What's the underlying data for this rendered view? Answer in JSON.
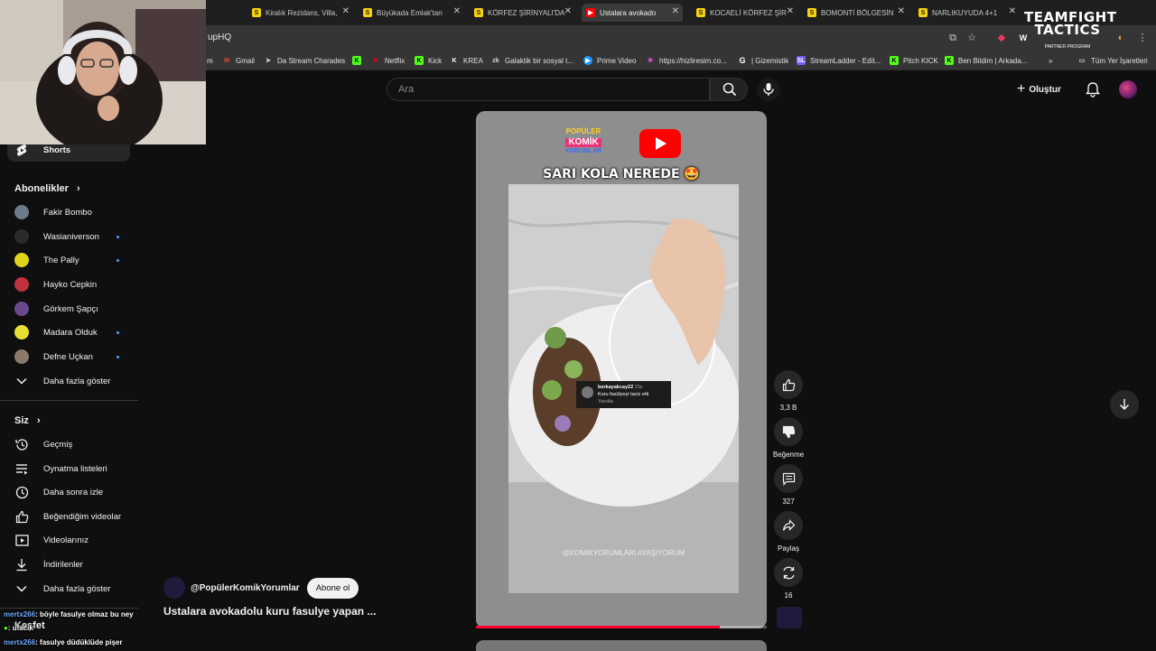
{
  "browser": {
    "tabs": [
      {
        "label": "Kiralık Rezidans, Villa,",
        "icon": "sahibinden-icon"
      },
      {
        "label": "Büyükada Emlak'tan",
        "icon": "sahibinden-icon"
      },
      {
        "label": "KÖRFEZ ŞİRİNYALI'DA",
        "icon": "sahibinden-icon"
      },
      {
        "label": "Ustalara avokado",
        "icon": "youtube-icon",
        "active": true
      },
      {
        "label": "KOCAELİ KÖRFEZ ŞİR",
        "icon": "sahibinden-icon"
      },
      {
        "label": "BOMONTİ BÖLGESİN",
        "icon": "sahibinden-icon"
      },
      {
        "label": "NARLIKUYUDA 4+1",
        "icon": "sahibinden-icon"
      }
    ],
    "url_visible": "upHQ",
    "bookmarks": [
      {
        "label": "m",
        "icon": "generic"
      },
      {
        "label": "Gmail",
        "icon": "gmail"
      },
      {
        "label": "Da Stream Charades",
        "icon": "charades"
      },
      {
        "label": "",
        "icon": "kick"
      },
      {
        "label": "Netflix",
        "icon": "netflix"
      },
      {
        "label": "Kick",
        "icon": "kick"
      },
      {
        "label": "KREA",
        "icon": "krea"
      },
      {
        "label": "Galaktik bir sosyal t...",
        "icon": "zk"
      },
      {
        "label": "Prime Video",
        "icon": "prime"
      },
      {
        "label": "https://hizliresim.co...",
        "icon": "hizli"
      },
      {
        "label": "| Gizemistik",
        "icon": "g"
      },
      {
        "label": "StreamLadder - Edit...",
        "icon": "sl"
      },
      {
        "label": "Pitch KICK",
        "icon": "kick"
      },
      {
        "label": "Ben Bildim | Arkada...",
        "icon": "kick"
      },
      {
        "label": "Tüm Yer İşaretleri",
        "icon": "folder"
      }
    ],
    "overflow_chevron": "»"
  },
  "header": {
    "search_placeholder": "Ara",
    "create_label": "Oluştur",
    "create_symbol": "+"
  },
  "sidebar": {
    "shorts_label": "Shorts",
    "subscriptions_heading": "Abonelikler",
    "subscriptions_arrow": "›",
    "channels": [
      {
        "name": "Fakir Bombo",
        "color": "#6b7b8c",
        "new": false
      },
      {
        "name": "Wasianiverson",
        "color": "#2b2b2b",
        "new": true
      },
      {
        "name": "The Pally",
        "color": "#e0d31b",
        "new": true
      },
      {
        "name": "Hayko Cepkin",
        "color": "#c0323c",
        "new": false
      },
      {
        "name": "Görkem Şapçı",
        "color": "#6a4a8c",
        "new": false
      },
      {
        "name": "Madara Olduk",
        "color": "#e8e032",
        "new": true
      },
      {
        "name": "Defne Uçkan",
        "color": "#8a7a6a",
        "new": true
      }
    ],
    "show_more_subs": "Daha fazla göster",
    "you_heading": "Siz",
    "you_arrow": "›",
    "you_items": [
      {
        "label": "Geçmiş",
        "icon": "history-icon"
      },
      {
        "label": "Oynatma listeleri",
        "icon": "playlists-icon"
      },
      {
        "label": "Daha sonra izle",
        "icon": "watch-later-icon"
      },
      {
        "label": "Beğendiğim videolar",
        "icon": "liked-videos-icon"
      },
      {
        "label": "Videolarınız",
        "icon": "your-videos-icon"
      },
      {
        "label": "İndirilenler",
        "icon": "downloads-icon"
      },
      {
        "label": "Daha fazla göster",
        "icon": "chevron-down-icon"
      }
    ],
    "explore_heading": "Keşfet"
  },
  "chat": [
    {
      "user": "mertx266",
      "message": ": böyle fasulye olmaz bu ney"
    },
    {
      "user": "",
      "message": ": ufacık"
    },
    {
      "user": "mertx266",
      "message": ": fasulye düdüklüde pişer"
    }
  ],
  "short": {
    "brand_line1": "POPÜLER",
    "brand_line2": "KOMİK",
    "brand_line3": "YORUMLAR",
    "overlay_caption": "SARI KOLA NEREDE",
    "overlay_emoji": "🤩",
    "comment_user": "berkayakcay22",
    "comment_time": "23s",
    "comment_text": "Kuru fasülyeyi taciz etti",
    "comment_reply": "Yanıtla",
    "watermark": "@KOMIKYORUMLARI AYAŞIYORUM",
    "progress": 0.84,
    "channel": "@PopülerKomikYorumlar",
    "subscribe_label": "Abone ol",
    "title": "Ustalara avokadolu kuru fasulye yapan ..."
  },
  "actions": {
    "likes": "3,3 B",
    "dislike_label": "Beğenme",
    "comments": "327",
    "share_label": "Paylaş",
    "remix_count": "16"
  },
  "overlay_badge": {
    "title": "TEAMFIGHT TACTICS",
    "subtitle": "PARTNER PROGRAM"
  },
  "colors": {
    "bg": "#0f0f0f",
    "accent_red": "#ff0000",
    "new_dot": "#3ea6ff"
  }
}
